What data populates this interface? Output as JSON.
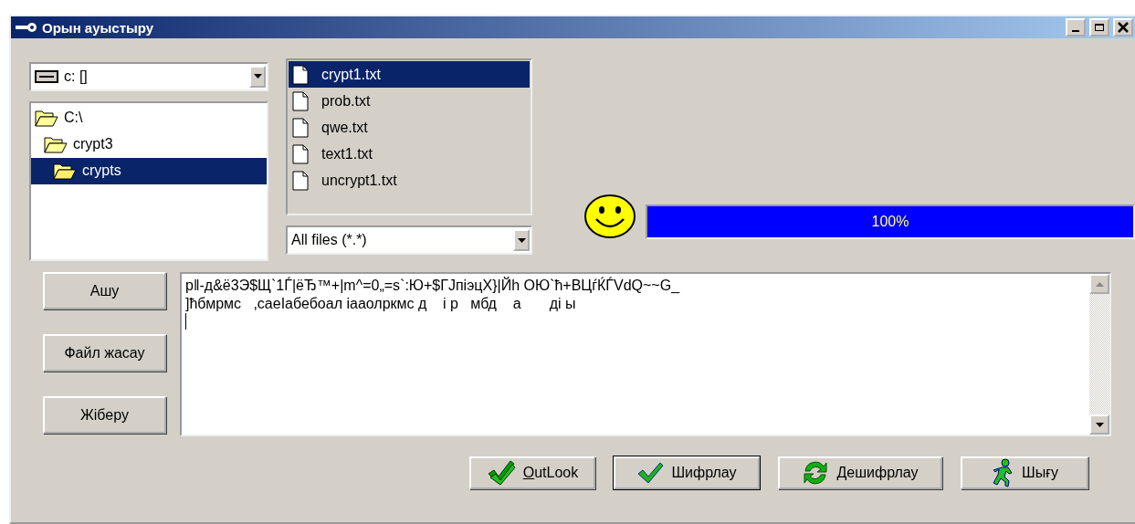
{
  "window": {
    "title": "Орын ауыстыру"
  },
  "drive_combo": {
    "value": "c: []"
  },
  "folders": [
    {
      "name": "C:\\",
      "selected": false,
      "children": [
        {
          "name": "crypt3",
          "selected": false,
          "children": [
            {
              "name": "crypts",
              "selected": true
            }
          ]
        }
      ]
    }
  ],
  "files": [
    {
      "name": "crypt1.txt",
      "selected": true
    },
    {
      "name": "prob.txt",
      "selected": false
    },
    {
      "name": "qwe.txt",
      "selected": false
    },
    {
      "name": "text1.txt",
      "selected": false
    },
    {
      "name": "uncrypt1.txt",
      "selected": false
    }
  ],
  "filter_combo": {
    "value": "All files (*.*)"
  },
  "progress": {
    "level": 1,
    "label": "100%"
  },
  "side_buttons": [
    "Ашу",
    "Файл жасау",
    "Жіберу"
  ],
  "memo": {
    "lines": [
      "p‖-д&ё3Э$Щ`1Ѓ|ёЂ™+|m^=0„=s`:Ю+$ГJпiэцХ}|Йh ОЮ`ћ+ВЦѓЌЃVdQ~~G_",
      "]ћбмрмс   ,caeIабебоал iааолркмс д    і р   мбд    а       ді ы"
    ]
  },
  "action_buttons": [
    {
      "kind": "double-check",
      "label": "OutLook",
      "underline_first": true,
      "default": false
    },
    {
      "kind": "check",
      "label": "Шифрлау",
      "default": true
    },
    {
      "kind": "refresh",
      "label": "Дешифрлау",
      "default": false
    },
    {
      "kind": "runner",
      "label": "Шығу",
      "default": false
    }
  ]
}
